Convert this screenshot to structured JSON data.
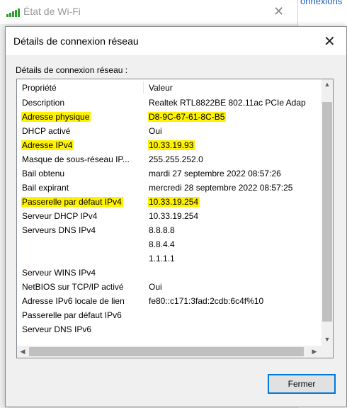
{
  "background_window": {
    "title": "État de Wi-Fi",
    "right_link_text": "onnexions"
  },
  "dialog": {
    "title": "Détails de connexion réseau",
    "group_label": "Détails de connexion réseau :",
    "columns": {
      "property": "Propriété",
      "value": "Valeur"
    },
    "rows": [
      {
        "prop": "Description",
        "val": "Realtek RTL8822BE 802.11ac PCIe Adap",
        "hl_prop": false,
        "hl_val": false
      },
      {
        "prop": "Adresse physique",
        "val": "D8-9C-67-61-8C-B5",
        "hl_prop": true,
        "hl_val": true
      },
      {
        "prop": "DHCP activé",
        "val": "Oui",
        "hl_prop": false,
        "hl_val": false
      },
      {
        "prop": "Adresse IPv4",
        "val": "10.33.19.93",
        "hl_prop": true,
        "hl_val": true
      },
      {
        "prop": "Masque de sous-réseau IP...",
        "val": "255.255.252.0",
        "hl_prop": false,
        "hl_val": false
      },
      {
        "prop": "Bail obtenu",
        "val": "mardi 27 septembre 2022 08:57:26",
        "hl_prop": false,
        "hl_val": false
      },
      {
        "prop": "Bail expirant",
        "val": "mercredi 28 septembre 2022 08:57:25",
        "hl_prop": false,
        "hl_val": false
      },
      {
        "prop": "Passerelle par défaut IPv4",
        "val": "10.33.19.254",
        "hl_prop": true,
        "hl_val": true
      },
      {
        "prop": "Serveur DHCP IPv4",
        "val": "10.33.19.254",
        "hl_prop": false,
        "hl_val": false
      },
      {
        "prop": "Serveurs DNS IPv4",
        "val": "8.8.8.8",
        "hl_prop": false,
        "hl_val": false
      },
      {
        "prop": "",
        "val": "8.8.4.4",
        "hl_prop": false,
        "hl_val": false
      },
      {
        "prop": "",
        "val": "1.1.1.1",
        "hl_prop": false,
        "hl_val": false
      },
      {
        "prop": "Serveur WINS IPv4",
        "val": "",
        "hl_prop": false,
        "hl_val": false
      },
      {
        "prop": "NetBIOS sur TCP/IP activé",
        "val": "Oui",
        "hl_prop": false,
        "hl_val": false
      },
      {
        "prop": "Adresse IPv6 locale de lien",
        "val": "fe80::c171:3fad:2cdb:6c4f%10",
        "hl_prop": false,
        "hl_val": false
      },
      {
        "prop": "Passerelle par défaut IPv6",
        "val": "",
        "hl_prop": false,
        "hl_val": false
      },
      {
        "prop": "Serveur DNS IPv6",
        "val": "",
        "hl_prop": false,
        "hl_val": false
      }
    ],
    "close_button_label": "Fermer",
    "highlight_color": "#fff200",
    "accent_color": "#0078d7"
  }
}
